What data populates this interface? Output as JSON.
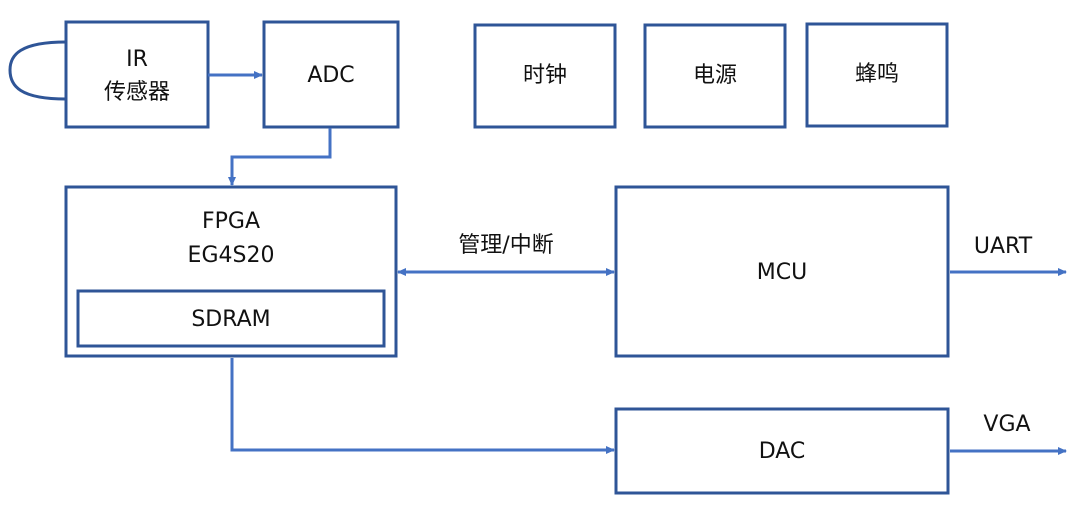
{
  "diagram": {
    "type": "block-diagram",
    "colors": {
      "box_border": "#2F5597",
      "connector": "#4472C4",
      "text": "#111111",
      "background": "#ffffff"
    },
    "blocks": {
      "ir_sensor": {
        "line1": "IR",
        "line2": "传感器"
      },
      "adc": {
        "label": "ADC"
      },
      "clock": {
        "label": "时钟"
      },
      "power": {
        "label": "电源"
      },
      "buzzer": {
        "label": "蜂鸣"
      },
      "fpga": {
        "line1": "FPGA",
        "line2": "EG4S20"
      },
      "sdram": {
        "label": "SDRAM"
      },
      "mcu": {
        "label": "MCU"
      },
      "dac": {
        "label": "DAC"
      }
    },
    "connections": [
      {
        "from": "IR 传感器",
        "to": "ADC",
        "direction": "forward",
        "label": ""
      },
      {
        "from": "ADC",
        "to": "FPGA",
        "direction": "forward",
        "label": ""
      },
      {
        "from": "FPGA",
        "to": "MCU",
        "direction": "bidirectional",
        "label": "管理/中断"
      },
      {
        "from": "MCU",
        "to": "output",
        "direction": "forward",
        "label": "UART"
      },
      {
        "from": "FPGA",
        "to": "DAC",
        "direction": "forward",
        "label": ""
      },
      {
        "from": "DAC",
        "to": "output",
        "direction": "forward",
        "label": "VGA"
      }
    ],
    "labels": {
      "fpga_mcu": "管理/中断",
      "uart": "UART",
      "vga": "VGA"
    }
  }
}
